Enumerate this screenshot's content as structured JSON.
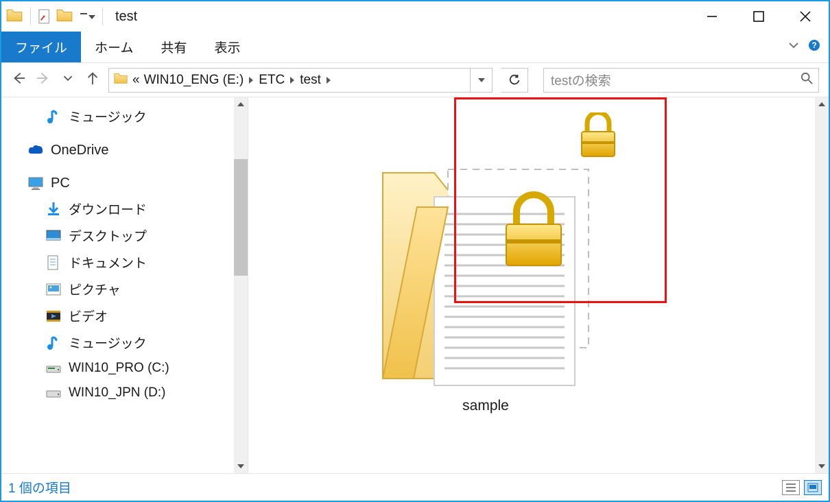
{
  "window": {
    "title": "test"
  },
  "ribbon": {
    "tabs": {
      "file": "ファイル",
      "home": "ホーム",
      "share": "共有",
      "view": "表示"
    }
  },
  "address": {
    "prefix": "«",
    "crumbs": [
      "WIN10_ENG (E:)",
      "ETC",
      "test"
    ]
  },
  "search": {
    "placeholder": "testの検索"
  },
  "sidebar": {
    "music": "ミュージック",
    "onedrive": "OneDrive",
    "pc": "PC",
    "downloads": "ダウンロード",
    "desktop": "デスクトップ",
    "documents": "ドキュメント",
    "pictures": "ピクチャ",
    "videos": "ビデオ",
    "music2": "ミュージック",
    "drive_c": "WIN10_PRO (C:)",
    "drive_d": "WIN10_JPN (D:)"
  },
  "content": {
    "item_name": "sample"
  },
  "status": {
    "count": "1 個の項目"
  }
}
